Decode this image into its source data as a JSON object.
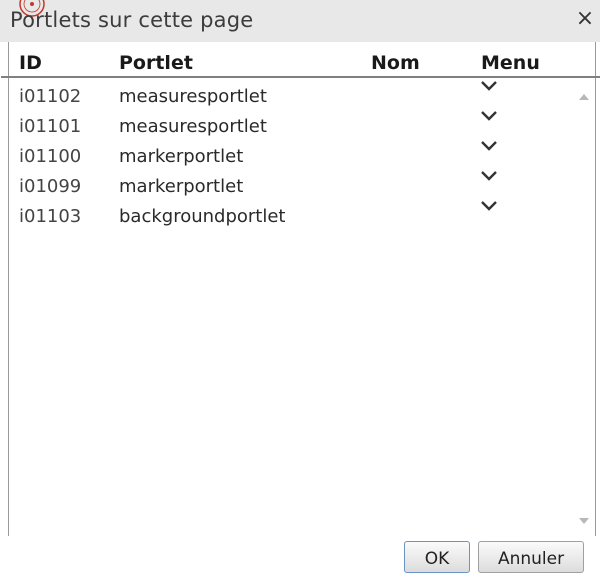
{
  "dialog": {
    "title": "Portlets sur cette page",
    "close_label": "×"
  },
  "table": {
    "columns": [
      "ID",
      "Portlet",
      "Nom",
      "Menu"
    ],
    "rows": [
      {
        "id": "i01102",
        "portlet": "measuresportlet",
        "nom": ""
      },
      {
        "id": "i01101",
        "portlet": "measuresportlet",
        "nom": ""
      },
      {
        "id": "i01100",
        "portlet": "markerportlet",
        "nom": ""
      },
      {
        "id": "i01099",
        "portlet": "markerportlet",
        "nom": ""
      },
      {
        "id": "i01103",
        "portlet": "backgroundportlet",
        "nom": ""
      }
    ]
  },
  "footer": {
    "ok_label": "OK",
    "cancel_label": "Annuler"
  },
  "icons": {
    "close": "close-icon",
    "menu": "chevron-down-icon",
    "scroll_up": "scroll-up-arrow-icon",
    "scroll_down": "scroll-down-arrow-icon",
    "stamp": "seal-stamp-icon"
  },
  "colors": {
    "titlebar": "#e8e8e8",
    "ok_border": "#6a93c6"
  }
}
